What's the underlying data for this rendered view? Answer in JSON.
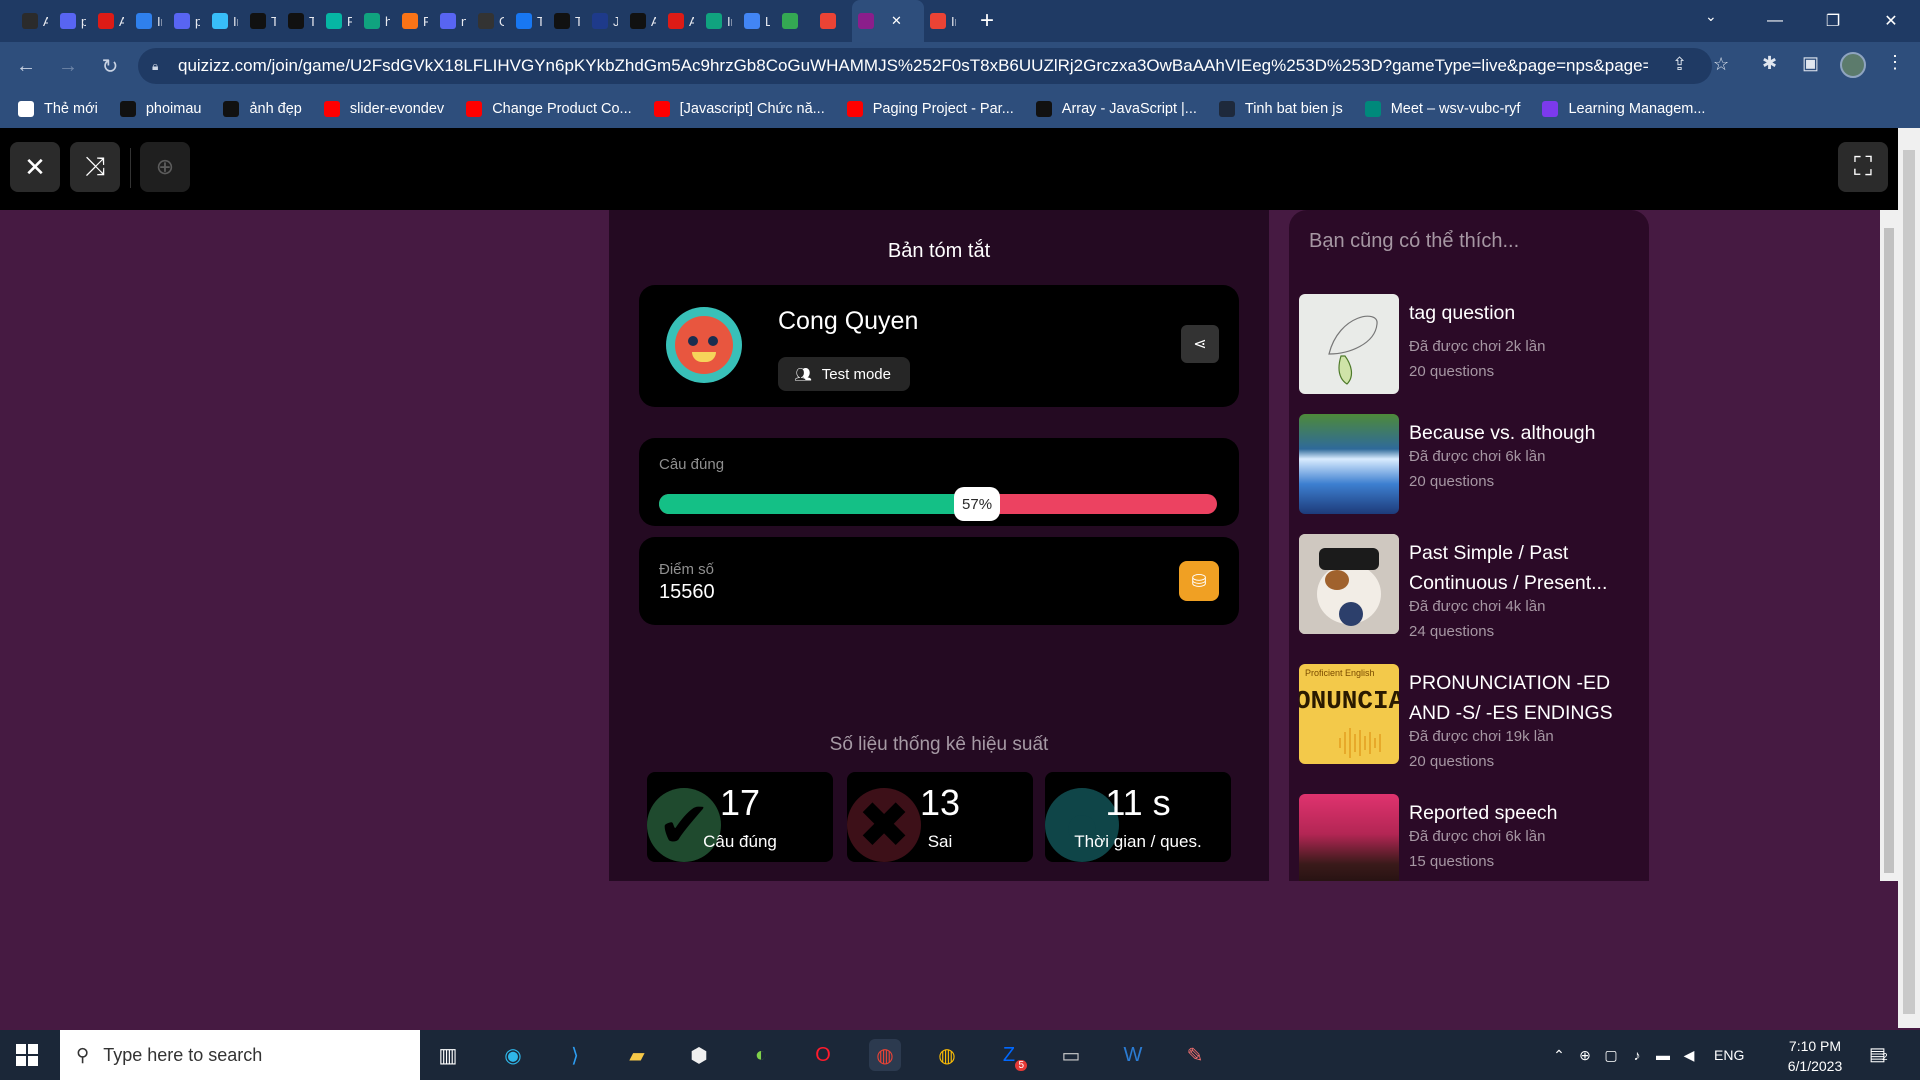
{
  "browser": {
    "tabs": [
      {
        "label": "An",
        "color": "#2b2b2b"
      },
      {
        "label": "prc",
        "color": "#5865f2"
      },
      {
        "label": "An",
        "color": "#dd1b16"
      },
      {
        "label": "Ins",
        "color": "#2f80ed"
      },
      {
        "label": "prc",
        "color": "#5865f2"
      },
      {
        "label": "Ins",
        "color": "#38bdf8"
      },
      {
        "label": "Tai",
        "color": "#111111"
      },
      {
        "label": "Tai",
        "color": "#111111"
      },
      {
        "label": "Prc",
        "color": "#06b6a4"
      },
      {
        "label": "htt",
        "color": "#10a37f"
      },
      {
        "label": "Pe",
        "color": "#f97316"
      },
      {
        "label": "no",
        "color": "#5865f2"
      },
      {
        "label": "Git",
        "color": "#333333"
      },
      {
        "label": "Tai",
        "color": "#1877f2"
      },
      {
        "label": "Tai",
        "color": "#111111"
      },
      {
        "label": "JSC",
        "color": "#1e3a8a"
      },
      {
        "label": "As",
        "color": "#111111"
      },
      {
        "label": "An",
        "color": "#dd1b16"
      },
      {
        "label": "Im",
        "color": "#10a37f"
      },
      {
        "label": "Lic",
        "color": "#4285f4"
      },
      {
        "label": "",
        "color": "#34a853"
      },
      {
        "label": "",
        "color": "#ea4335"
      }
    ],
    "active_tab": {
      "label": "",
      "color": "#8b1e8b"
    },
    "after_tab": {
      "label": "Int",
      "color": "#ea4335"
    },
    "url": "quizizz.com/join/game/U2FsdGVkX18LFLIHVGYn6pKYkbZhdGm5Ac9hrzGb8CoGuWHAMMJS%252F0sT8xB6UUZlRj2Grczxa3OwBaAAhVIEeg%253D%253D?gameType=live&page=nps&page=...",
    "bookmarks": [
      {
        "label": "Thẻ mới",
        "icon": "globe-icon",
        "color": "#ffffff"
      },
      {
        "label": "phoimau",
        "icon": "phoimau-icon",
        "color": "#111111"
      },
      {
        "label": "ảnh đẹp",
        "icon": "unsplash-icon",
        "color": "#111111"
      },
      {
        "label": "slider-evondev",
        "icon": "youtube-icon",
        "color": "#ff0000"
      },
      {
        "label": "Change Product Co...",
        "icon": "youtube-icon",
        "color": "#ff0000"
      },
      {
        "label": "[Javascript] Chức nă...",
        "icon": "youtube-icon",
        "color": "#ff0000"
      },
      {
        "label": "Paging Project - Par...",
        "icon": "youtube-icon",
        "color": "#ff0000"
      },
      {
        "label": "Array - JavaScript |...",
        "icon": "mdn-icon",
        "color": "#111111"
      },
      {
        "label": "Tinh bat bien js",
        "icon": "code-icon",
        "color": "#1e293b"
      },
      {
        "label": "Meet – wsv-vubc-ryf",
        "icon": "meet-icon",
        "color": "#00897b"
      },
      {
        "label": "Learning Managem...",
        "icon": "lms-icon",
        "color": "#7c3aed"
      }
    ]
  },
  "summary": {
    "title": "Bản tóm tắt",
    "player_name": "Cong Quyen",
    "mode": "Test mode",
    "accuracy_label": "Câu đúng",
    "accuracy_percent": "57%",
    "accuracy_value": 57,
    "score_label": "Điểm số",
    "score": "15560",
    "stats_title": "Số liệu thống kê hiệu suất",
    "stats": [
      {
        "value": "17",
        "label": "Câu đúng",
        "icon": "check-icon",
        "color": "#14c086"
      },
      {
        "value": "13",
        "label": "Sai",
        "icon": "x-icon",
        "color": "#ec4261"
      },
      {
        "value": "11 s",
        "label": "Thời gian / ques.",
        "icon": "timer-icon",
        "color": "#38c0b8"
      }
    ]
  },
  "recs": {
    "title": "Bạn cũng có thể thích...",
    "items": [
      {
        "title": "tag question",
        "plays": "Đã được chơi 2k lần",
        "questions": "20 questions",
        "thumb": "sketch"
      },
      {
        "title": "Because vs. although",
        "plays": "Đã được chơi 6k lần",
        "questions": "20 questions",
        "thumb": "waterfall"
      },
      {
        "title": "Past Simple / Past Continuous / Present...",
        "plays": "Đã được chơi 4k lần",
        "questions": "24 questions",
        "thumb": "cat"
      },
      {
        "title": "PRONUNCIATION -ED AND -S/ -ES ENDINGS",
        "plays": "Đã được chơi 19k lần",
        "questions": "20 questions",
        "thumb": "pronunciation",
        "thumb_caption": "Proficient English",
        "thumb_word": "ONUNCIATI"
      },
      {
        "title": "Reported speech",
        "plays": "Đã được chơi 6k lần",
        "questions": "15 questions",
        "thumb": "crowd"
      }
    ]
  },
  "taskbar": {
    "search_placeholder": "Type here to search",
    "language": "ENG",
    "time": "7:10 PM",
    "date": "6/1/2023",
    "notification_count": "2",
    "zalo_badge": "5"
  }
}
